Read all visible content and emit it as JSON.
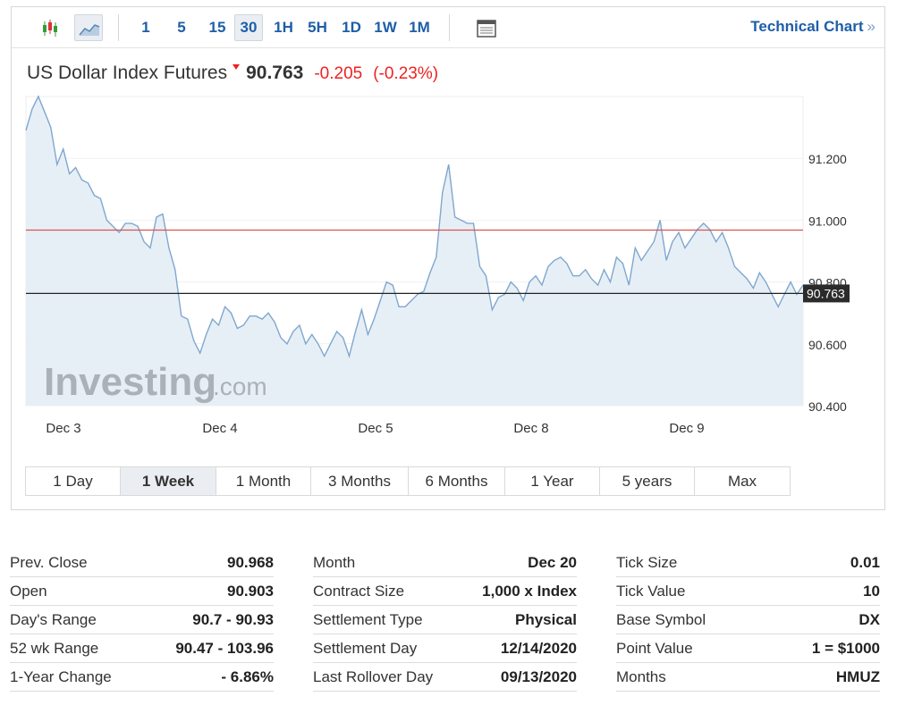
{
  "toolbar": {
    "icons": [
      "candlestick-icon",
      "area-chart-icon"
    ],
    "timeframes": [
      "1",
      "5",
      "15",
      "30",
      "1H",
      "5H",
      "1D",
      "1W",
      "1M"
    ],
    "active_timeframe": "30",
    "tech_link_label": "Technical Chart",
    "tech_link_chevron": "»"
  },
  "quote": {
    "name": "US Dollar Index Futures",
    "last": "90.763",
    "change": "-0.205",
    "change_pct": "(-0.23%)"
  },
  "colors": {
    "accent": "#1e5ea8",
    "negative": "#e22222",
    "line": "#7fa7cf",
    "area": "#e3ecf4",
    "prev_close_line": "#d9534f",
    "current_line": "#222222"
  },
  "chart_data": {
    "type": "area",
    "x_labels": [
      "Dec 3",
      "Dec 4",
      "Dec 5",
      "Dec 8",
      "Dec 9"
    ],
    "y_ticks": [
      "91.200",
      "91.000",
      "90.800",
      "90.600",
      "90.400"
    ],
    "ylim": [
      90.4,
      91.4
    ],
    "prev_close": 90.968,
    "current": 90.763,
    "current_label": "90.763",
    "watermark": "Investing",
    "watermark_suffix": ".com",
    "x": [
      0,
      0.2,
      0.4,
      0.6,
      0.8,
      1.0,
      1.2,
      1.4,
      1.6,
      1.8,
      2.0,
      2.2,
      2.4,
      2.6,
      2.8,
      3.0,
      3.2,
      3.4,
      3.6,
      3.8,
      4.0,
      4.2,
      4.4,
      4.6,
      4.8,
      5.0,
      5.2,
      5.4,
      5.6,
      5.8,
      6.0,
      6.2,
      6.4,
      6.6,
      6.8,
      7.0,
      7.2,
      7.4,
      7.6,
      7.8,
      8.0,
      8.2,
      8.4,
      8.6,
      8.8,
      9.0,
      9.2,
      9.4,
      9.6,
      9.8,
      10.0,
      10.2,
      10.4,
      10.6,
      10.8,
      11.0,
      11.2,
      11.4,
      11.6,
      11.8,
      12.0,
      12.2,
      12.4,
      12.6,
      12.8,
      13.0,
      13.2,
      13.4,
      13.6,
      13.8,
      14.0,
      14.2,
      14.4,
      14.6,
      14.8,
      15.0,
      15.2,
      15.4,
      15.6,
      15.8,
      16.0,
      16.2,
      16.4,
      16.6,
      16.8,
      17.0,
      17.2,
      17.4,
      17.6,
      17.8,
      18.0,
      18.2,
      18.4,
      18.6,
      18.8,
      19.0,
      19.2,
      19.4,
      19.6,
      19.8,
      20.0,
      20.2,
      20.4,
      20.6,
      20.8,
      21.0,
      21.2,
      21.4,
      21.6,
      21.8,
      22.0,
      22.2,
      22.4,
      22.6,
      22.8,
      23.0,
      23.2,
      23.4,
      23.6,
      23.8,
      24.0,
      24.2,
      24.4,
      24.6,
      24.8,
      25.0
    ],
    "values": [
      91.29,
      91.36,
      91.4,
      91.35,
      91.3,
      91.18,
      91.23,
      91.15,
      91.17,
      91.13,
      91.12,
      91.08,
      91.07,
      91.0,
      90.98,
      90.96,
      90.99,
      90.99,
      90.98,
      90.93,
      90.91,
      91.01,
      91.02,
      90.91,
      90.84,
      90.69,
      90.68,
      90.61,
      90.57,
      90.63,
      90.68,
      90.66,
      90.72,
      90.7,
      90.65,
      90.66,
      90.69,
      90.69,
      90.68,
      90.7,
      90.67,
      90.62,
      90.6,
      90.64,
      90.66,
      90.6,
      90.63,
      90.6,
      90.56,
      90.6,
      90.64,
      90.62,
      90.56,
      90.64,
      90.71,
      90.63,
      90.68,
      90.74,
      90.8,
      90.79,
      90.72,
      90.72,
      90.74,
      90.76,
      90.77,
      90.83,
      90.88,
      91.09,
      91.18,
      91.01,
      91.0,
      90.99,
      90.99,
      90.85,
      90.82,
      90.71,
      90.75,
      90.76,
      90.8,
      90.78,
      90.74,
      90.8,
      90.82,
      90.79,
      90.85,
      90.87,
      90.88,
      90.86,
      90.82,
      90.82,
      90.84,
      90.81,
      90.79,
      90.84,
      90.8,
      90.88,
      90.86,
      90.79,
      90.91,
      90.87,
      90.9,
      90.93,
      91.0,
      90.87,
      90.93,
      90.96,
      90.91,
      90.94,
      90.97,
      90.99,
      90.97,
      90.93,
      90.96,
      90.91,
      90.85,
      90.83,
      90.81,
      90.78,
      90.83,
      90.8,
      90.76,
      90.72,
      90.76,
      90.8,
      90.76,
      90.79
    ]
  },
  "ranges": [
    "1 Day",
    "1 Week",
    "1 Month",
    "3 Months",
    "6 Months",
    "1 Year",
    "5 years",
    "Max"
  ],
  "active_range": "1 Week",
  "stats": [
    [
      {
        "label": "Prev. Close",
        "value": "90.968"
      },
      {
        "label": "Open",
        "value": "90.903"
      },
      {
        "label": "Day's Range",
        "value": "90.7 - 90.93"
      },
      {
        "label": "52 wk Range",
        "value": "90.47 - 103.96"
      },
      {
        "label": "1-Year Change",
        "value": "- 6.86%"
      }
    ],
    [
      {
        "label": "Month",
        "value": "Dec 20"
      },
      {
        "label": "Contract Size",
        "value": "1,000 x Index"
      },
      {
        "label": "Settlement Type",
        "value": "Physical"
      },
      {
        "label": "Settlement Day",
        "value": "12/14/2020"
      },
      {
        "label": "Last Rollover Day",
        "value": "09/13/2020"
      }
    ],
    [
      {
        "label": "Tick Size",
        "value": "0.01"
      },
      {
        "label": "Tick Value",
        "value": "10"
      },
      {
        "label": "Base Symbol",
        "value": "DX"
      },
      {
        "label": "Point Value",
        "value": "1 = $1000"
      },
      {
        "label": "Months",
        "value": "HMUZ"
      }
    ]
  ]
}
